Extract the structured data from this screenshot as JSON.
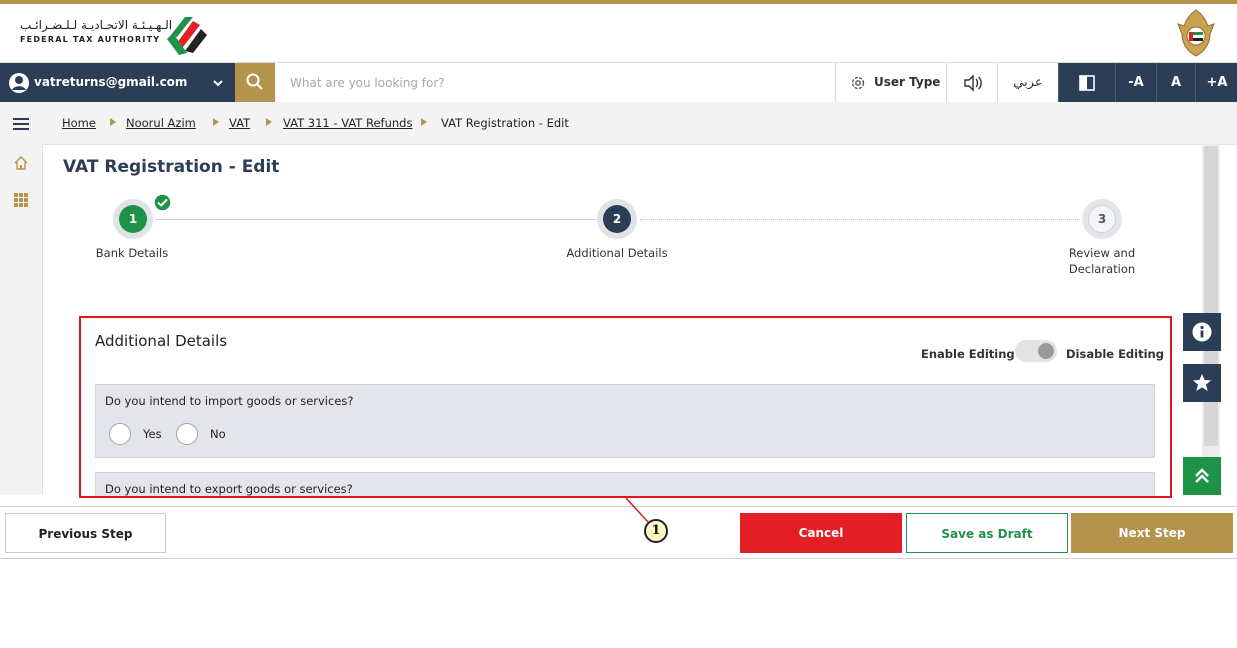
{
  "header": {
    "logo_arabic": "الـهـيـئـة الاتحـاديـة لـلـضـرائـب",
    "logo_english": "FEDERAL TAX AUTHORITY"
  },
  "topbar": {
    "user_email": "vatreturns@gmail.com",
    "search_placeholder": "What are you looking for?",
    "user_type_label": "User Type",
    "arabic_label": "عربي",
    "font_decrease": "-A",
    "font_normal": "A",
    "font_increase": "+A"
  },
  "breadcrumb": {
    "items": [
      "Home",
      "Noorul Azim",
      "VAT",
      "VAT 311 - VAT Refunds",
      "VAT Registration - Edit"
    ]
  },
  "page": {
    "title": "VAT Registration - Edit"
  },
  "stepper": {
    "steps": [
      {
        "number": "1",
        "label_line1": "Bank Details",
        "label_line2": "",
        "status": "completed"
      },
      {
        "number": "2",
        "label_line1": "Additional Details",
        "label_line2": "",
        "status": "current"
      },
      {
        "number": "3",
        "label_line1": "Review and",
        "label_line2": "Declaration",
        "status": "pending"
      }
    ]
  },
  "section": {
    "title": "Additional Details",
    "enable_editing": "Enable Editing",
    "disable_editing": "Disable Editing",
    "questions": [
      {
        "text": "Do you intend to import goods or services?",
        "options": [
          "Yes",
          "No"
        ]
      },
      {
        "text": "Do you intend to export goods or services?",
        "options": []
      }
    ]
  },
  "footer": {
    "previous": "Previous Step",
    "cancel": "Cancel",
    "save_draft": "Save as Draft",
    "next": "Next Step"
  },
  "annotation": {
    "callout_number": "1"
  },
  "colors": {
    "navy": "#2c3e55",
    "gold": "#b4934d",
    "green": "#1e9247",
    "red": "#e31e24"
  }
}
